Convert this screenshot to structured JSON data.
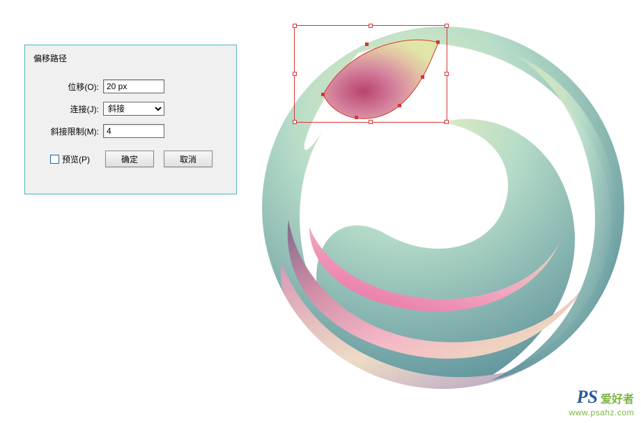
{
  "dialog": {
    "title": "偏移路径",
    "offset": {
      "label": "位移(O):",
      "value": "20 px"
    },
    "join": {
      "label": "连接(J):",
      "value": "斜接"
    },
    "miter": {
      "label": "斜接限制(M):",
      "value": "4"
    },
    "preview_label": "预览(P)",
    "ok_label": "确定",
    "cancel_label": "取消"
  },
  "watermark": {
    "logo_left": "PS",
    "logo_right": "爱好者",
    "url": "www.psahz.com"
  },
  "colors": {
    "dialog_border": "#4fb3c4",
    "selection": "#D93333"
  }
}
